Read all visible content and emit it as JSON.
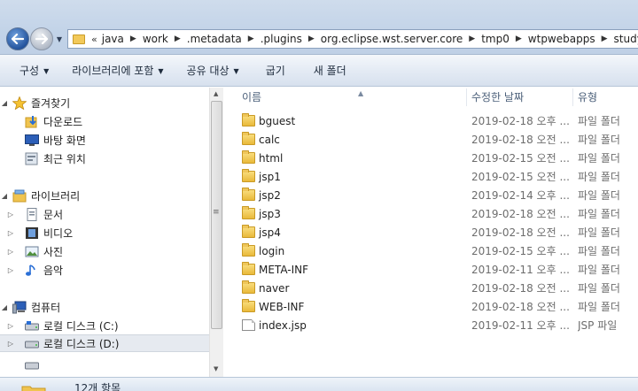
{
  "address": {
    "overflow": "«",
    "crumbs": [
      "java",
      "work",
      ".metadata",
      ".plugins",
      "org.eclipse.wst.server.core",
      "tmp0",
      "wtpwebapps",
      "study"
    ]
  },
  "toolbar": {
    "organize": "구성",
    "include_library": "라이브러리에 포함",
    "share": "공유 대상",
    "burn": "굽기",
    "new_folder": "새 폴더"
  },
  "nav": {
    "favorites": {
      "label": "즐겨찾기",
      "items": [
        "다운로드",
        "바탕 화면",
        "최근 위치"
      ]
    },
    "libraries": {
      "label": "라이브러리",
      "items": [
        "문서",
        "비디오",
        "사진",
        "음악"
      ]
    },
    "computer": {
      "label": "컴퓨터",
      "items": [
        "로컬 디스크 (C:)",
        "로컬 디스크 (D:)"
      ]
    }
  },
  "columns": {
    "name": "이름",
    "date": "수정한 날짜",
    "type": "유형"
  },
  "files": [
    {
      "name": "bguest",
      "date": "2019-02-18 오후 ...",
      "type": "파일 폴더",
      "kind": "folder"
    },
    {
      "name": "calc",
      "date": "2019-02-18 오전 ...",
      "type": "파일 폴더",
      "kind": "folder"
    },
    {
      "name": "html",
      "date": "2019-02-15 오전 ...",
      "type": "파일 폴더",
      "kind": "folder"
    },
    {
      "name": "jsp1",
      "date": "2019-02-15 오전 ...",
      "type": "파일 폴더",
      "kind": "folder"
    },
    {
      "name": "jsp2",
      "date": "2019-02-14 오후 ...",
      "type": "파일 폴더",
      "kind": "folder"
    },
    {
      "name": "jsp3",
      "date": "2019-02-18 오전 ...",
      "type": "파일 폴더",
      "kind": "folder"
    },
    {
      "name": "jsp4",
      "date": "2019-02-18 오전 ...",
      "type": "파일 폴더",
      "kind": "folder"
    },
    {
      "name": "login",
      "date": "2019-02-15 오후 ...",
      "type": "파일 폴더",
      "kind": "folder"
    },
    {
      "name": "META-INF",
      "date": "2019-02-11 오후 ...",
      "type": "파일 폴더",
      "kind": "folder"
    },
    {
      "name": "naver",
      "date": "2019-02-18 오전 ...",
      "type": "파일 폴더",
      "kind": "folder"
    },
    {
      "name": "WEB-INF",
      "date": "2019-02-18 오전 ...",
      "type": "파일 폴더",
      "kind": "folder"
    },
    {
      "name": "index.jsp",
      "date": "2019-02-11 오후 ...",
      "type": "JSP 파일",
      "kind": "file"
    }
  ],
  "status": {
    "item_count": "12개 항목"
  },
  "colors": {
    "accent": "#1f4f99",
    "toolbar": "#e3eaf4",
    "selection": "#e6eaf0"
  }
}
